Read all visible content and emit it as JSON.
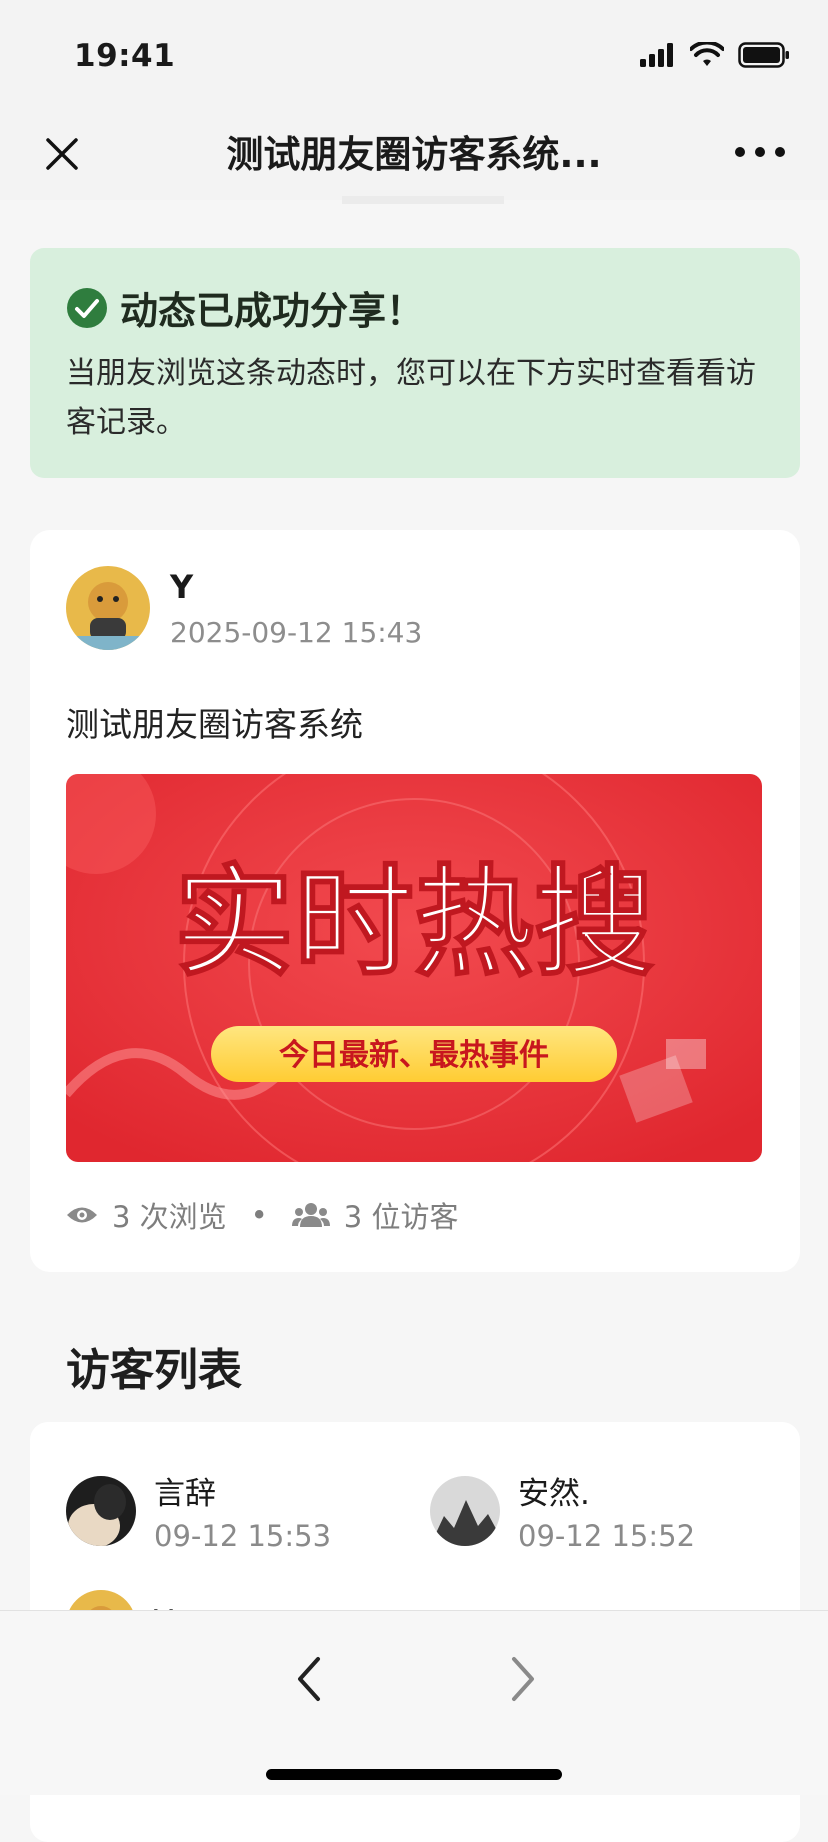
{
  "status_bar": {
    "time": "19:41"
  },
  "nav": {
    "title": "测试朋友圈访客系统..."
  },
  "banner": {
    "title": "动态已成功分享！",
    "description": "当朋友浏览这条动态时，您可以在下方实时查看看访客记录。"
  },
  "post": {
    "author": "Y",
    "timestamp": "2025-09-12 15:43",
    "text": "测试朋友圈访客系统",
    "image": {
      "headline": "实时热搜",
      "tagline": "今日最新、最热事件"
    },
    "stats": {
      "views": "3 次浏览",
      "separator": "•",
      "visitors": "3 位访客"
    }
  },
  "visitors_section": {
    "title": "访客列表",
    "items": [
      {
        "name": "言辞",
        "time": "09-12 15:53"
      },
      {
        "name": "安然.",
        "time": "09-12 15:52"
      },
      {
        "name": "Y",
        "time": ""
      }
    ]
  },
  "colors": {
    "banner_bg": "#d8efdd",
    "check_green": "#2f7d3e",
    "image_red": "#e8353c",
    "tagline_yellow": "#ffd84a"
  },
  "icons": [
    "close-icon",
    "more-icon",
    "check-circle-icon",
    "eye-icon",
    "users-icon",
    "chevron-left-icon",
    "chevron-right-icon",
    "signal-icon",
    "wifi-icon",
    "battery-icon"
  ]
}
